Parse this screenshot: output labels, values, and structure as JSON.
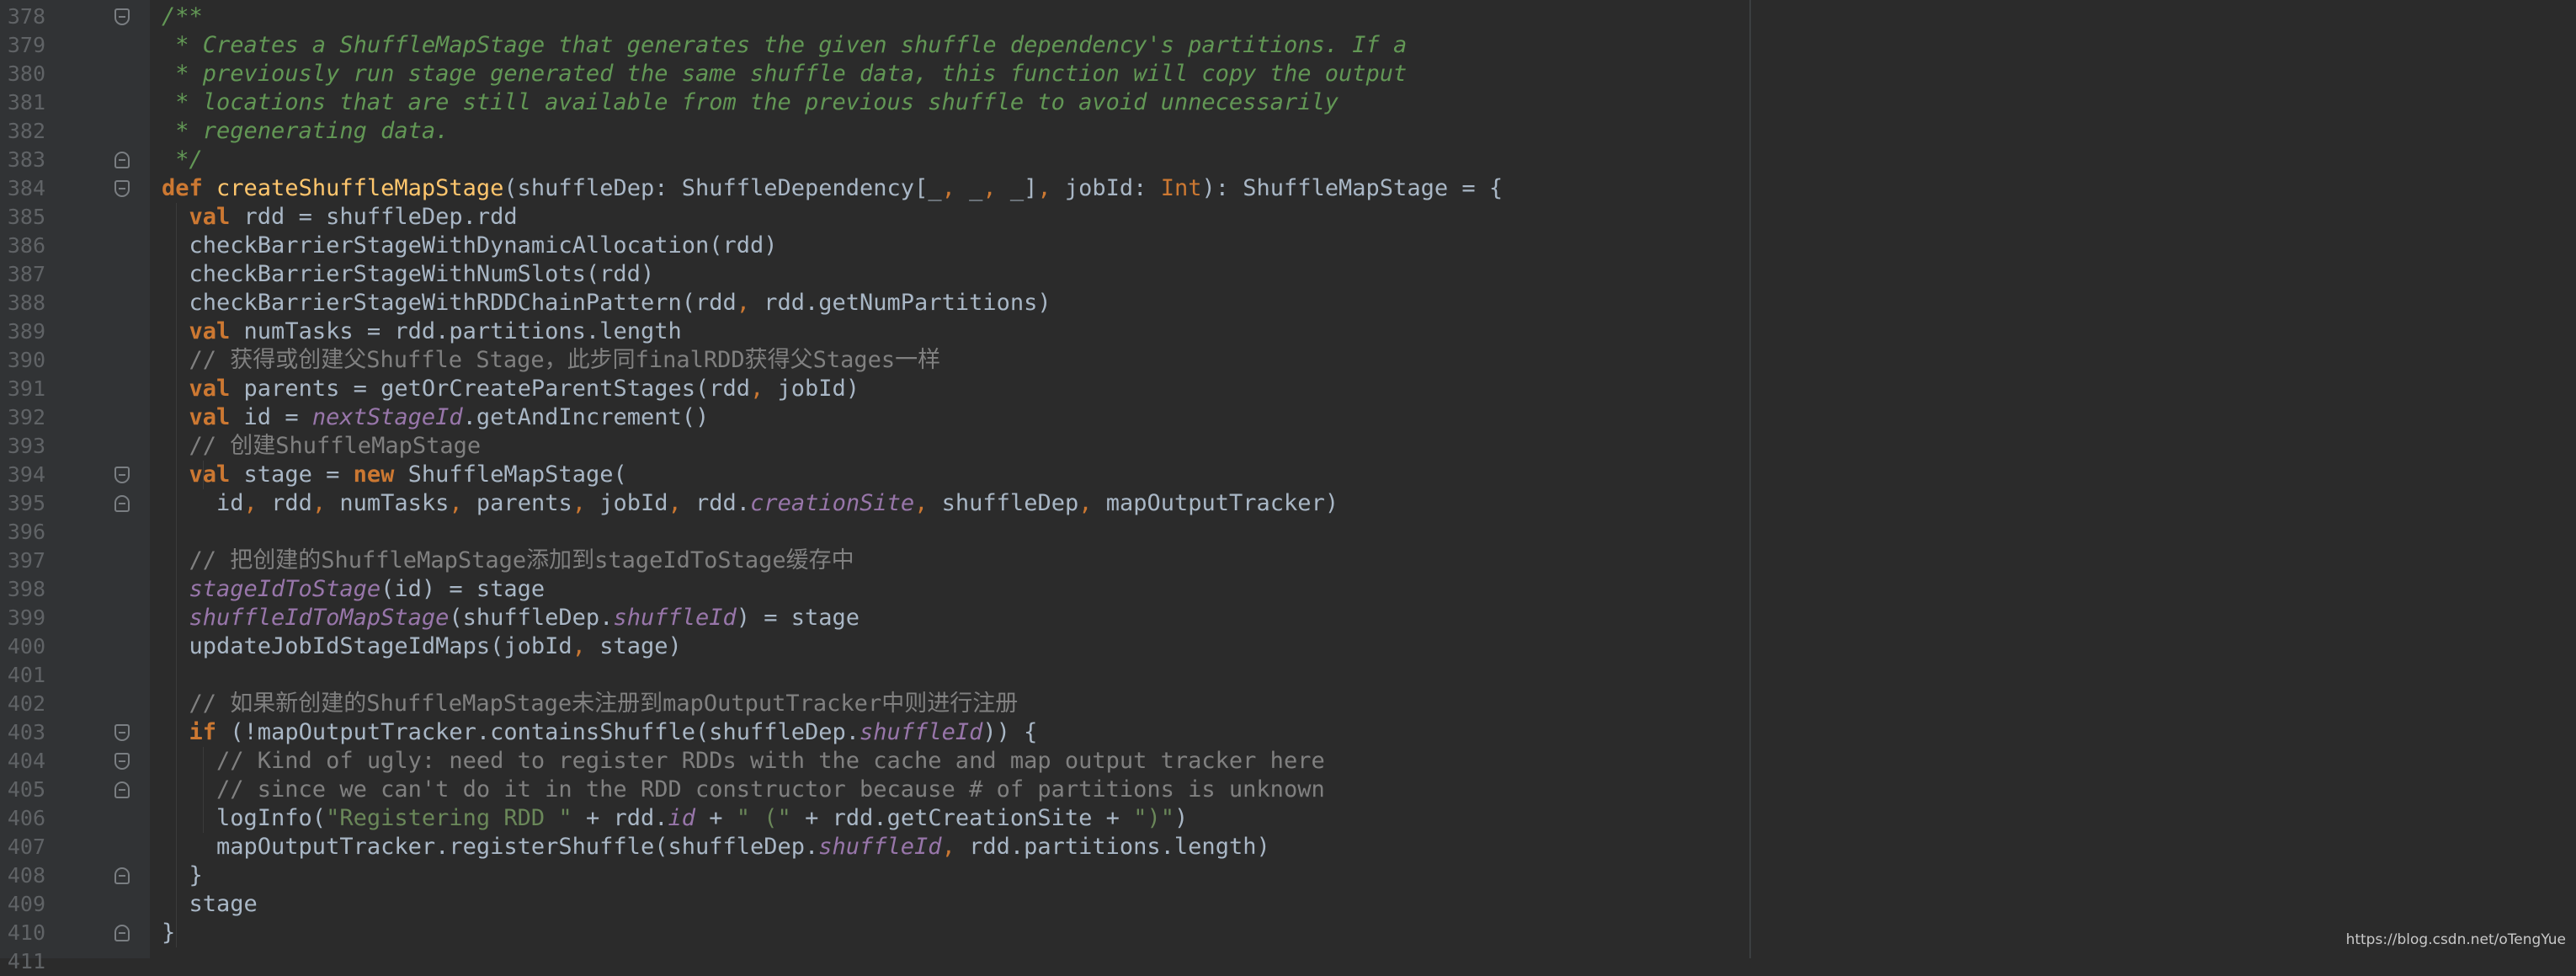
{
  "editor": {
    "watermark": "https://blog.csdn.net/oTengYue",
    "lines": [
      {
        "n": "378",
        "fold": "open",
        "tokens": [
          {
            "t": "/**",
            "c": "doc"
          }
        ]
      },
      {
        "n": "379",
        "fold": "",
        "tokens": [
          {
            "t": " * Creates a ShuffleMapStage that generates the given shuffle dependency's partitions. If a",
            "c": "doc"
          }
        ]
      },
      {
        "n": "380",
        "fold": "",
        "tokens": [
          {
            "t": " * previously run stage generated the same shuffle data, this function will copy the output",
            "c": "doc"
          }
        ]
      },
      {
        "n": "381",
        "fold": "",
        "tokens": [
          {
            "t": " * locations that are still available from the previous shuffle to avoid unnecessarily",
            "c": "doc"
          }
        ]
      },
      {
        "n": "382",
        "fold": "",
        "tokens": [
          {
            "t": " * regenerating data.",
            "c": "doc"
          }
        ]
      },
      {
        "n": "383",
        "fold": "close",
        "tokens": [
          {
            "t": " */",
            "c": "doc"
          }
        ]
      },
      {
        "n": "384",
        "fold": "open",
        "tokens": [
          {
            "t": "def ",
            "c": "kw"
          },
          {
            "t": "createShuffleMapStage",
            "c": "fn"
          },
          {
            "t": "(shuffleDep: ShuffleDependency[_",
            "c": ""
          },
          {
            "t": ", ",
            "c": "op"
          },
          {
            "t": "_",
            "c": ""
          },
          {
            "t": ", ",
            "c": "op"
          },
          {
            "t": "_]",
            "c": ""
          },
          {
            "t": ", ",
            "c": "op"
          },
          {
            "t": "jobId: ",
            "c": ""
          },
          {
            "t": "Int",
            "c": "num-ty"
          },
          {
            "t": "): ShuffleMapStage = {",
            "c": ""
          }
        ]
      },
      {
        "n": "385",
        "fold": "",
        "tokens": [
          {
            "t": "  ",
            "c": ""
          },
          {
            "t": "val ",
            "c": "kw"
          },
          {
            "t": "rdd = shuffleDep.rdd",
            "c": ""
          }
        ]
      },
      {
        "n": "386",
        "fold": "",
        "tokens": [
          {
            "t": "  checkBarrierStageWithDynamicAllocation(rdd)",
            "c": ""
          }
        ]
      },
      {
        "n": "387",
        "fold": "",
        "tokens": [
          {
            "t": "  checkBarrierStageWithNumSlots(rdd)",
            "c": ""
          }
        ]
      },
      {
        "n": "388",
        "fold": "",
        "tokens": [
          {
            "t": "  checkBarrierStageWithRDDChainPattern(rdd",
            "c": ""
          },
          {
            "t": ", ",
            "c": "op"
          },
          {
            "t": "rdd.getNumPartitions)",
            "c": ""
          }
        ]
      },
      {
        "n": "389",
        "fold": "",
        "tokens": [
          {
            "t": "  ",
            "c": ""
          },
          {
            "t": "val ",
            "c": "kw"
          },
          {
            "t": "numTasks = rdd.partitions.length",
            "c": ""
          }
        ]
      },
      {
        "n": "390",
        "fold": "",
        "tokens": [
          {
            "t": "  // 获得或创建父Shuffle Stage，此步同finalRDD获得父Stages一样",
            "c": "cm"
          }
        ]
      },
      {
        "n": "391",
        "fold": "",
        "tokens": [
          {
            "t": "  ",
            "c": ""
          },
          {
            "t": "val ",
            "c": "kw"
          },
          {
            "t": "parents = getOrCreateParentStages(rdd",
            "c": ""
          },
          {
            "t": ", ",
            "c": "op"
          },
          {
            "t": "jobId)",
            "c": ""
          }
        ]
      },
      {
        "n": "392",
        "fold": "",
        "tokens": [
          {
            "t": "  ",
            "c": ""
          },
          {
            "t": "val ",
            "c": "kw"
          },
          {
            "t": "id = ",
            "c": ""
          },
          {
            "t": "nextStageId",
            "c": "fld"
          },
          {
            "t": ".getAndIncrement()",
            "c": ""
          }
        ]
      },
      {
        "n": "393",
        "fold": "",
        "tokens": [
          {
            "t": "  // 创建ShuffleMapStage",
            "c": "cm"
          }
        ]
      },
      {
        "n": "394",
        "fold": "open",
        "tokens": [
          {
            "t": "  ",
            "c": ""
          },
          {
            "t": "val ",
            "c": "kw"
          },
          {
            "t": "stage = ",
            "c": ""
          },
          {
            "t": "new ",
            "c": "kw"
          },
          {
            "t": "ShuffleMapStage(",
            "c": ""
          }
        ]
      },
      {
        "n": "395",
        "fold": "close",
        "tokens": [
          {
            "t": "    id",
            "c": ""
          },
          {
            "t": ", ",
            "c": "op"
          },
          {
            "t": "rdd",
            "c": ""
          },
          {
            "t": ", ",
            "c": "op"
          },
          {
            "t": "numTasks",
            "c": ""
          },
          {
            "t": ", ",
            "c": "op"
          },
          {
            "t": "parents",
            "c": ""
          },
          {
            "t": ", ",
            "c": "op"
          },
          {
            "t": "jobId",
            "c": ""
          },
          {
            "t": ", ",
            "c": "op"
          },
          {
            "t": "rdd.",
            "c": ""
          },
          {
            "t": "creationSite",
            "c": "fld"
          },
          {
            "t": ", ",
            "c": "op"
          },
          {
            "t": "shuffleDep",
            "c": ""
          },
          {
            "t": ", ",
            "c": "op"
          },
          {
            "t": "mapOutputTracker)",
            "c": ""
          }
        ]
      },
      {
        "n": "396",
        "fold": "",
        "tokens": []
      },
      {
        "n": "397",
        "fold": "",
        "tokens": [
          {
            "t": "  // 把创建的ShuffleMapStage添加到stageIdToStage缓存中",
            "c": "cm"
          }
        ]
      },
      {
        "n": "398",
        "fold": "",
        "tokens": [
          {
            "t": "  ",
            "c": ""
          },
          {
            "t": "stageIdToStage",
            "c": "fld"
          },
          {
            "t": "(id) = stage",
            "c": ""
          }
        ]
      },
      {
        "n": "399",
        "fold": "",
        "tokens": [
          {
            "t": "  ",
            "c": ""
          },
          {
            "t": "shuffleIdToMapStage",
            "c": "fld"
          },
          {
            "t": "(shuffleDep.",
            "c": ""
          },
          {
            "t": "shuffleId",
            "c": "fld"
          },
          {
            "t": ") = stage",
            "c": ""
          }
        ]
      },
      {
        "n": "400",
        "fold": "",
        "tokens": [
          {
            "t": "  updateJobIdStageIdMaps(jobId",
            "c": ""
          },
          {
            "t": ", ",
            "c": "op"
          },
          {
            "t": "stage)",
            "c": ""
          }
        ]
      },
      {
        "n": "401",
        "fold": "",
        "tokens": []
      },
      {
        "n": "402",
        "fold": "",
        "tokens": [
          {
            "t": "  // 如果新创建的ShuffleMapStage未注册到mapOutputTracker中则进行注册",
            "c": "cm"
          }
        ]
      },
      {
        "n": "403",
        "fold": "open",
        "tokens": [
          {
            "t": "  ",
            "c": ""
          },
          {
            "t": "if ",
            "c": "kw"
          },
          {
            "t": "(!mapOutputTracker.containsShuffle(shuffleDep.",
            "c": ""
          },
          {
            "t": "shuffleId",
            "c": "fld"
          },
          {
            "t": ")) {",
            "c": ""
          }
        ]
      },
      {
        "n": "404",
        "fold": "open",
        "tokens": [
          {
            "t": "    // Kind of ugly: need to register RDDs with the cache and map output tracker here",
            "c": "cm"
          }
        ]
      },
      {
        "n": "405",
        "fold": "close",
        "tokens": [
          {
            "t": "    // since we can't do it in the RDD constructor because # of partitions is unknown",
            "c": "cm"
          }
        ]
      },
      {
        "n": "406",
        "fold": "",
        "tokens": [
          {
            "t": "    logInfo(",
            "c": ""
          },
          {
            "t": "\"Registering RDD \"",
            "c": "str"
          },
          {
            "t": " + rdd.",
            "c": ""
          },
          {
            "t": "id",
            "c": "fld"
          },
          {
            "t": " + ",
            "c": ""
          },
          {
            "t": "\" (\"",
            "c": "str"
          },
          {
            "t": " + rdd.getCreationSite + ",
            "c": ""
          },
          {
            "t": "\")\"",
            "c": "str"
          },
          {
            "t": ")",
            "c": ""
          }
        ]
      },
      {
        "n": "407",
        "fold": "",
        "tokens": [
          {
            "t": "    mapOutputTracker.registerShuffle(shuffleDep.",
            "c": ""
          },
          {
            "t": "shuffleId",
            "c": "fld"
          },
          {
            "t": ", ",
            "c": "op"
          },
          {
            "t": "rdd.partitions.length)",
            "c": ""
          }
        ]
      },
      {
        "n": "408",
        "fold": "close",
        "tokens": [
          {
            "t": "  }",
            "c": ""
          }
        ]
      },
      {
        "n": "409",
        "fold": "",
        "tokens": [
          {
            "t": "  stage",
            "c": ""
          }
        ]
      },
      {
        "n": "410",
        "fold": "close",
        "tokens": [
          {
            "t": "}",
            "c": ""
          }
        ]
      },
      {
        "n": "411",
        "fold": "",
        "tokens": []
      }
    ]
  }
}
